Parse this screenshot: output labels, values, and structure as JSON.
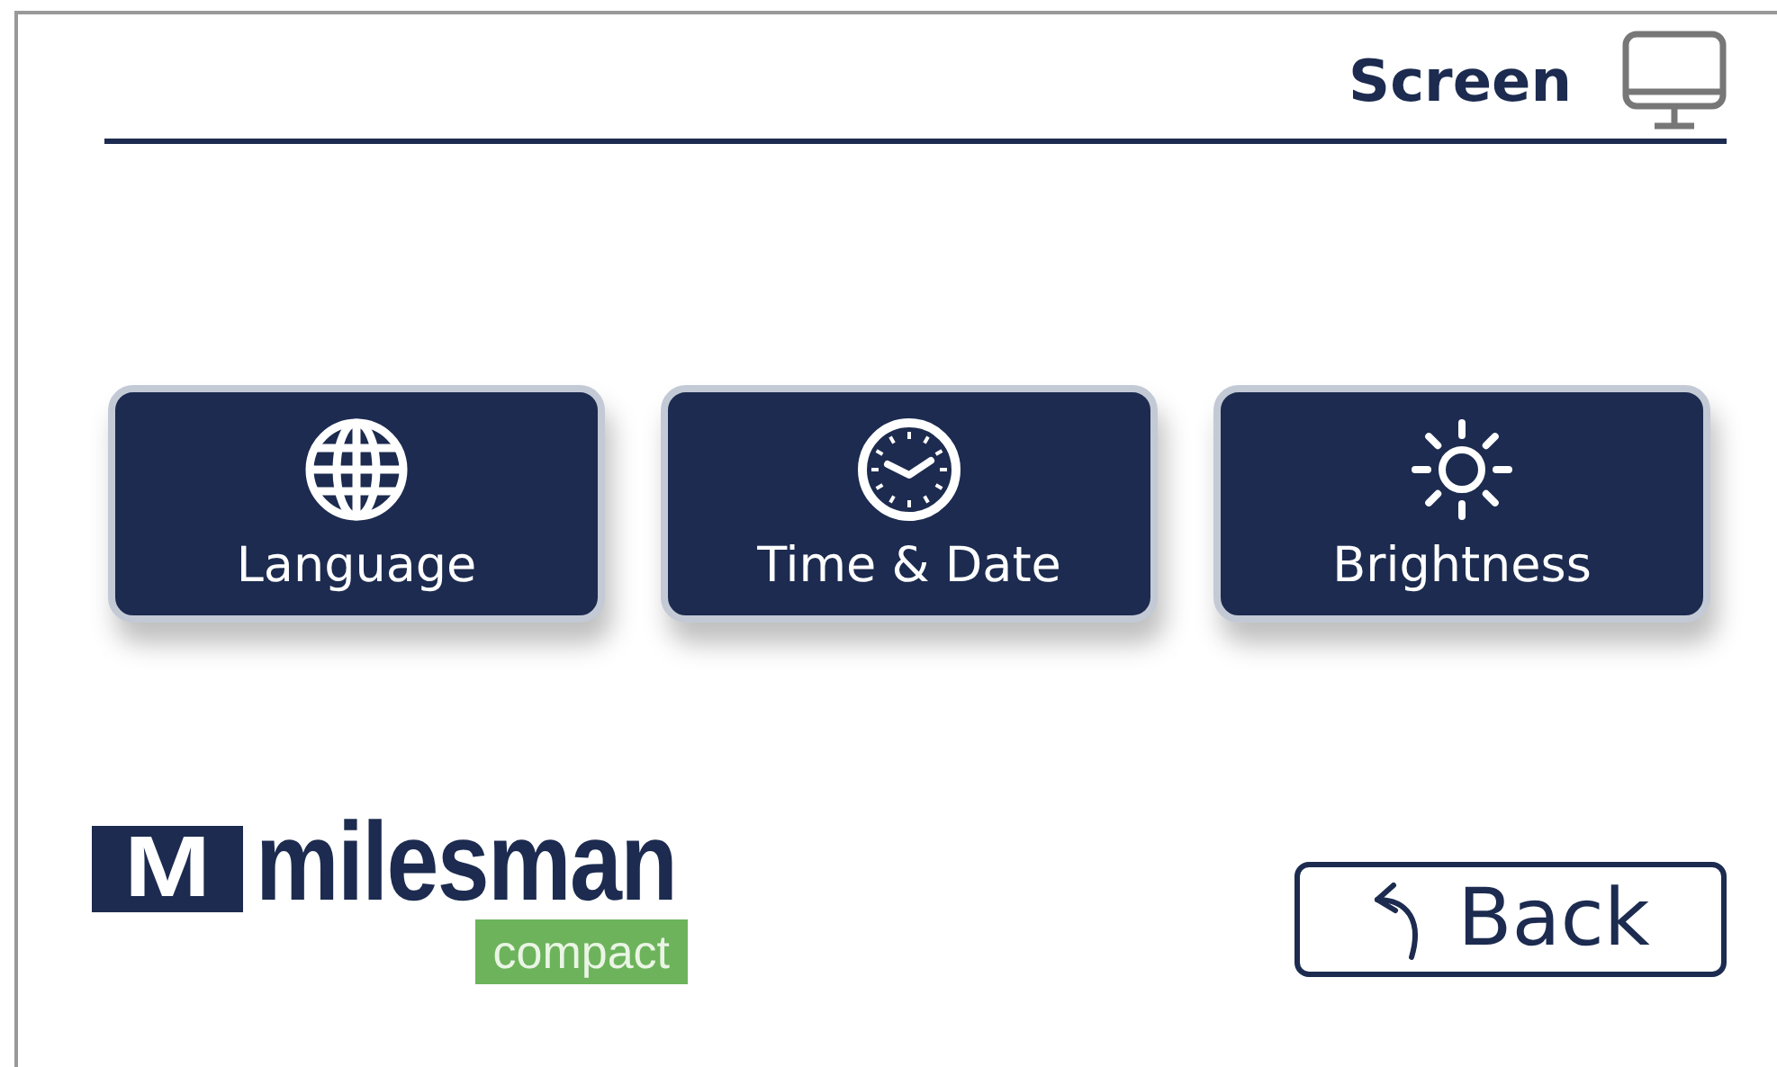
{
  "header": {
    "title": "Screen"
  },
  "menu_buttons": [
    {
      "label": "Language",
      "kind": "globe"
    },
    {
      "label": "Time & Date",
      "kind": "clock"
    },
    {
      "label": "Brightness",
      "kind": "sun"
    }
  ],
  "logo": {
    "mark": "M",
    "name": "milesman",
    "tagline": "compact"
  },
  "back_button": {
    "label": "Back"
  }
}
